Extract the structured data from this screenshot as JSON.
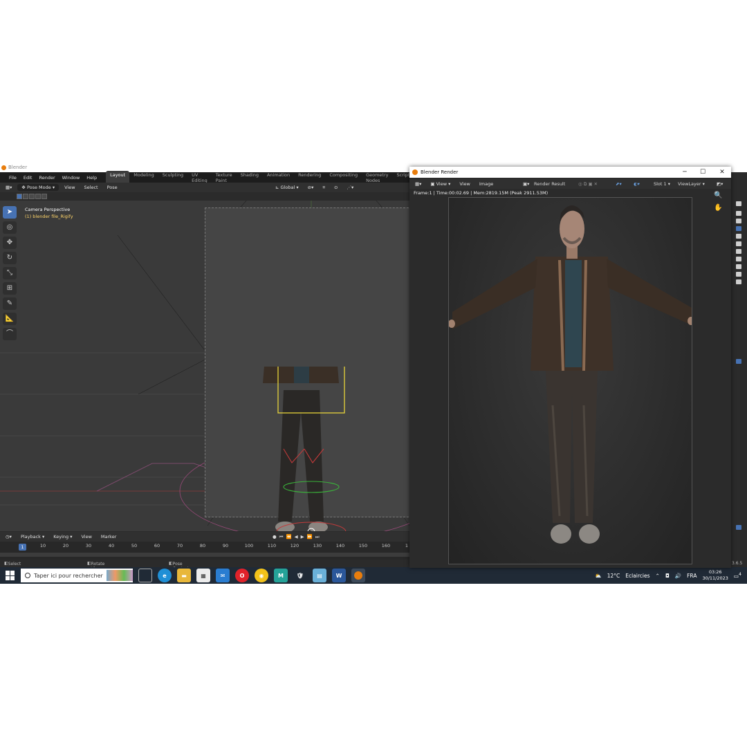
{
  "window": {
    "title": "Blender"
  },
  "menubar": {
    "menus": [
      "File",
      "Edit",
      "Render",
      "Window",
      "Help"
    ],
    "workspaces": [
      "Layout",
      "Modeling",
      "Sculpting",
      "UV Editing",
      "Texture Paint",
      "Shading",
      "Animation",
      "Rendering",
      "Compositing",
      "Geometry Nodes",
      "Scripting"
    ],
    "active_workspace": "Layout"
  },
  "viewport_header": {
    "mode": "Pose Mode",
    "menus": [
      "View",
      "Select",
      "Pose"
    ],
    "transform_orientation": "Global"
  },
  "viewport": {
    "view_name": "Camera Perspective",
    "object_name": "(1) blender file_Rigify"
  },
  "timeline": {
    "menus": [
      "Playback",
      "Keying",
      "View",
      "Marker"
    ],
    "current_frame": "1",
    "ticks": [
      "10",
      "20",
      "30",
      "40",
      "50",
      "60",
      "70",
      "80",
      "90",
      "100",
      "110",
      "120",
      "130",
      "140",
      "150",
      "160",
      "1"
    ]
  },
  "statusbar": {
    "select": "Select",
    "rotate": "Rotate View",
    "context": "Pose Context Menu",
    "version": "3.6.5"
  },
  "render_window": {
    "title": "Blender Render",
    "menus": [
      "View",
      "Image"
    ],
    "image_name": "Render Result",
    "slot": "Slot 1",
    "view_layer": "ViewLayer",
    "frame_info": "Frame:1 | Time:00:02.69 | Mem:2819.15M (Peak 2911.53M)"
  },
  "taskbar": {
    "search_placeholder": "Taper ici pour rechercher",
    "weather_temp": "12°C",
    "weather_desc": "Eclaircies",
    "language": "FRA",
    "time": "03:26",
    "date": "30/11/2023",
    "notifications": "4"
  },
  "colors": {
    "accent": "#4772b3",
    "blender_orange": "#e87d0d",
    "object_name": "#ffd56a"
  }
}
